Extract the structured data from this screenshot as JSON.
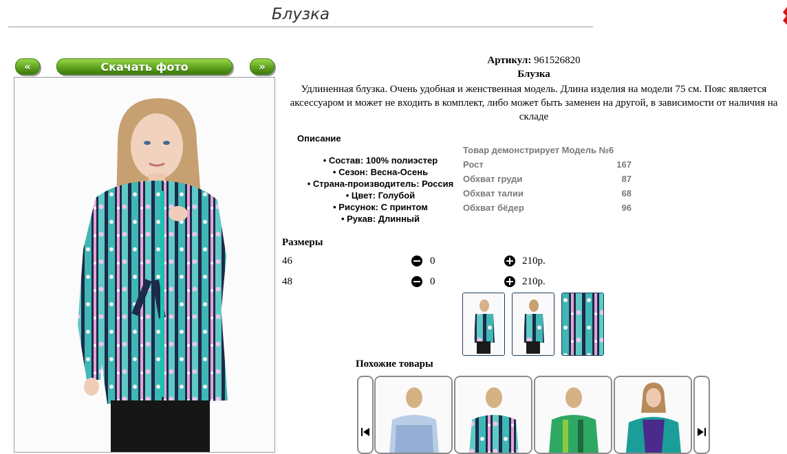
{
  "page": {
    "title": "Блузка"
  },
  "gallery": {
    "prev_label": "«",
    "download_label": "Скачать фото",
    "next_label": "»"
  },
  "product": {
    "article_label": "Артикул:",
    "article_value": "961526820",
    "name": "Блузка",
    "description": "Удлиненная блузка. Очень удобная и женственная модель. Длина изделия на модели 75 см. Пояс является аксессуаром и может не входить в комплект, либо может быть заменен на другой, в зависимости от наличия на складе"
  },
  "description_block": {
    "heading": "Описание",
    "properties": [
      "Состав: 100% полиэстер",
      "Сезон: Весна-Осень",
      "Страна-производитель: Россия",
      "Цвет: Голубой",
      "Рисунок: С принтом",
      "Рукав: Длинный"
    ]
  },
  "model": {
    "heading": "Товар демонстрирует Модель №6",
    "rows": [
      {
        "label": "Рост",
        "value": "167"
      },
      {
        "label": "Обхват груди",
        "value": "87"
      },
      {
        "label": "Обхват талии",
        "value": "68"
      },
      {
        "label": "Обхват бёдер",
        "value": "96"
      }
    ]
  },
  "sizes": {
    "heading": "Размеры",
    "rows": [
      {
        "size": "46",
        "qty": "0",
        "price": "210р."
      },
      {
        "size": "48",
        "qty": "0",
        "price": "210р."
      }
    ]
  },
  "similar": {
    "heading": "Похожие товары"
  },
  "colors": {
    "button_green": "#5fa31e",
    "model_text": "#7a7a7a",
    "thumb_border": "#1c3a5a"
  }
}
